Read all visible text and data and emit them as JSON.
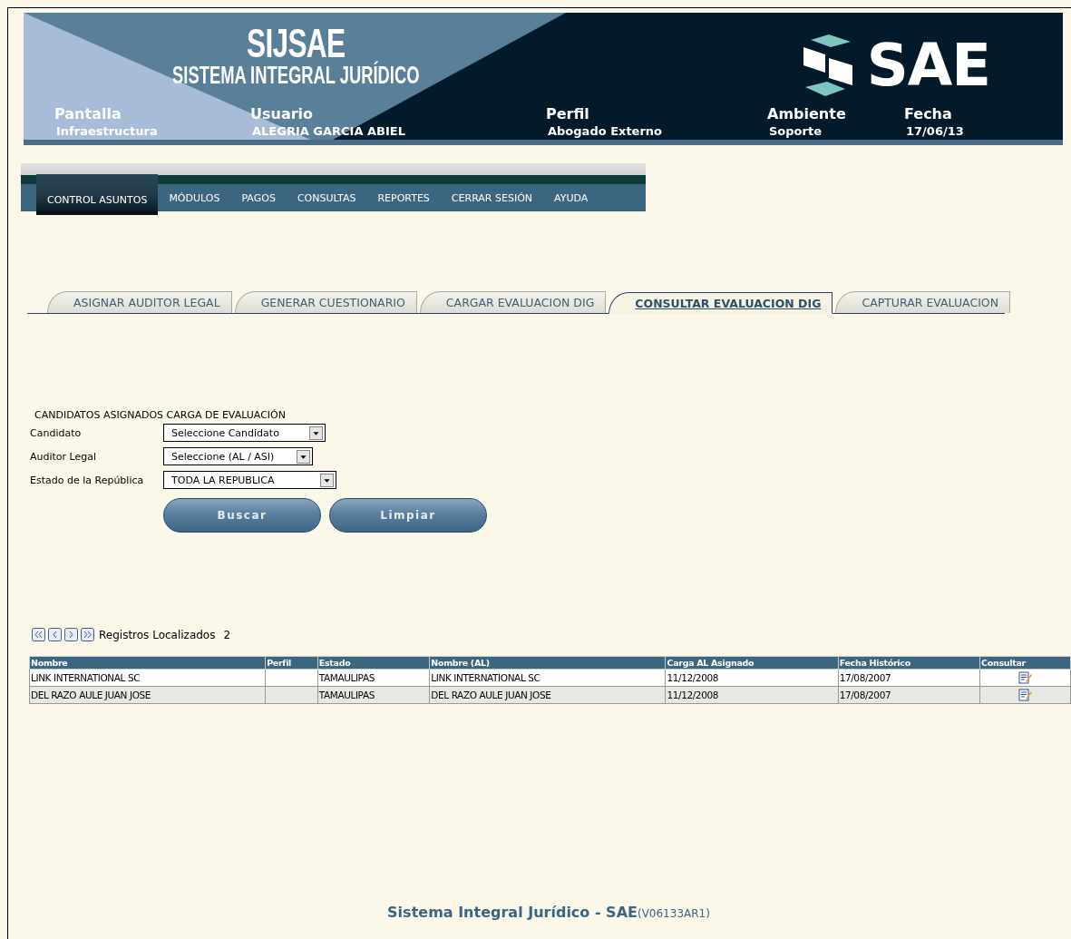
{
  "header": {
    "title": "SIJSAE",
    "subtitle": "SISTEMA INTEGRAL JURÍDICO",
    "logo_text": "SAE",
    "fields": [
      {
        "label": "Pantalla",
        "value": "Infraestructura"
      },
      {
        "label": "Usuario",
        "value": "ALEGRIA GARCIA ABIEL"
      },
      {
        "label": "Perfil",
        "value": "Abogado Externo"
      },
      {
        "label": "Ambiente",
        "value": "Soporte"
      },
      {
        "label": "Fecha",
        "value": "17/06/13"
      }
    ]
  },
  "menu": [
    {
      "label": "CONTROL ASUNTOS",
      "selected": true
    },
    {
      "label": "MÓDULOS",
      "selected": false
    },
    {
      "label": "PAGOS",
      "selected": false
    },
    {
      "label": "CONSULTAS",
      "selected": false
    },
    {
      "label": "REPORTES",
      "selected": false
    },
    {
      "label": "CERRAR SESIÓN",
      "selected": false
    },
    {
      "label": "AYUDA",
      "selected": false
    }
  ],
  "tabs": [
    {
      "label": "ASIGNAR AUDITOR LEGAL",
      "selected": false
    },
    {
      "label": "GENERAR CUESTIONARIO",
      "selected": false
    },
    {
      "label": "CARGAR EVALUACION DIG",
      "selected": false
    },
    {
      "label": "CONSULTAR EVALUACION DIG",
      "selected": true
    },
    {
      "label": "CAPTURAR EVALUACION",
      "selected": false
    }
  ],
  "form": {
    "title": "CANDIDATOS ASIGNADOS CARGA DE EVALUACIÓN",
    "fields": [
      {
        "label": "Candidato",
        "value": "Seleccione Candidato"
      },
      {
        "label": "Auditor Legal",
        "value": "Seleccione (AL / ASI)"
      },
      {
        "label": "Estado de la República",
        "value": "TODA LA REPUBLICA"
      }
    ],
    "buttons": [
      "Buscar",
      "Limpiar"
    ]
  },
  "pager": {
    "label": "Registros Localizados",
    "count": "2"
  },
  "table": {
    "columns": [
      "Nombre",
      "Perfil",
      "Estado",
      "Nombre (AL)",
      "Carga AL Asignado",
      "Fecha Histórico",
      "Consultar"
    ],
    "rows": [
      {
        "cells": [
          "LINK INTERNATIONAL SC",
          "",
          "TAMAULIPAS",
          "LINK INTERNATIONAL SC",
          "11/12/2008",
          "17/08/2007"
        ]
      },
      {
        "cells": [
          "DEL RAZO AULE JUAN JOSE",
          "",
          "TAMAULIPAS",
          "DEL RAZO AULE JUAN JOSE",
          "11/12/2008",
          "17/08/2007"
        ]
      }
    ]
  },
  "footer": {
    "title": "Sistema Integral Jurídico - SAE",
    "version": "(V06133AR1)"
  }
}
